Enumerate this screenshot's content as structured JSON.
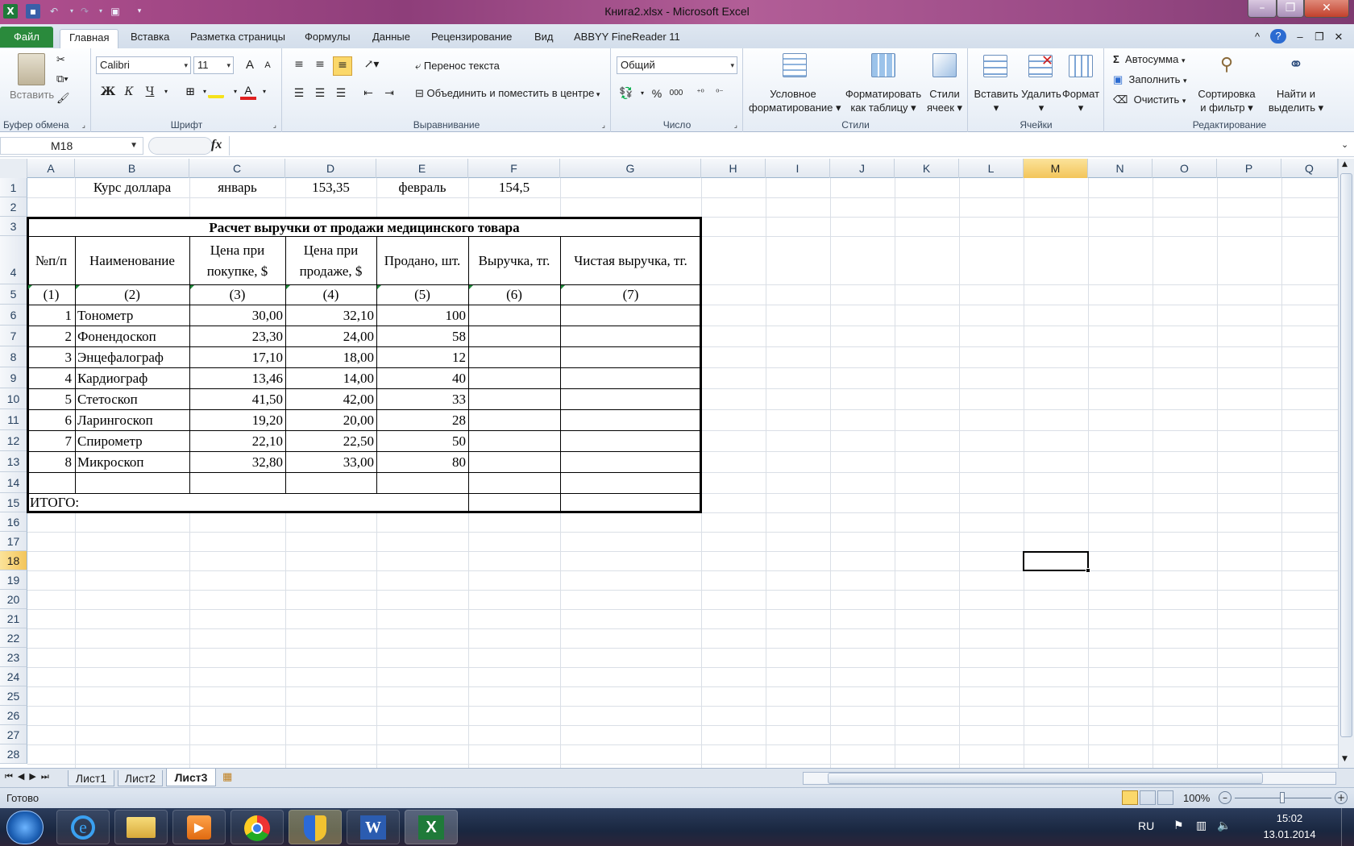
{
  "window": {
    "title": "Книга2.xlsx - Microsoft Excel"
  },
  "ribbon_tabs": [
    "Файл",
    "Главная",
    "Вставка",
    "Разметка страницы",
    "Формулы",
    "Данные",
    "Рецензирование",
    "Вид",
    "ABBYY FineReader 11"
  ],
  "clipboard": {
    "paste": "Вставить",
    "label": "Буфер обмена"
  },
  "font": {
    "name": "Calibri",
    "size": "11",
    "bold": "Ж",
    "italic": "К",
    "underline": "Ч",
    "label": "Шрифт",
    "grow": "A",
    "shrink": "A"
  },
  "alignment": {
    "wrap": "Перенос текста",
    "merge": "Объединить и поместить в центре",
    "label": "Выравнивание"
  },
  "number": {
    "format": "Общий",
    "percent": "%",
    "thousands": "000",
    "label": "Число"
  },
  "styles": {
    "conditional": [
      "Условное",
      "форматирование"
    ],
    "as_table": [
      "Форматировать",
      "как таблицу"
    ],
    "cell_styles": [
      "Стили",
      "ячеек"
    ],
    "label": "Стили"
  },
  "cells_group": {
    "insert": "Вставить",
    "delete": "Удалить",
    "format": "Формат",
    "label": "Ячейки"
  },
  "editing": {
    "autosum": "Автосумма",
    "fill": "Заполнить",
    "clear": "Очистить",
    "sort": [
      "Сортировка",
      "и фильтр"
    ],
    "find": [
      "Найти и",
      "выделить"
    ],
    "label": "Редактирование",
    "sigma": "Σ"
  },
  "formula_bar": {
    "name_box": "M18",
    "fx": "fx",
    "formula": ""
  },
  "columns": [
    "A",
    "B",
    "C",
    "D",
    "E",
    "F",
    "G",
    "H",
    "I",
    "J",
    "K",
    "L",
    "M",
    "N",
    "O",
    "P",
    "Q"
  ],
  "rows": [
    "1",
    "2",
    "3",
    "4",
    "5",
    "6",
    "7",
    "8",
    "9",
    "10",
    "11",
    "12",
    "13",
    "14",
    "15",
    "16",
    "17",
    "18",
    "19",
    "20",
    "21",
    "22",
    "23",
    "24",
    "25",
    "26",
    "27",
    "28"
  ],
  "active_cell": "M18",
  "sheet": {
    "rate": {
      "label": "Курс доллара",
      "m1": "январь",
      "v1": "153,35",
      "m2": "февраль",
      "v2": "154,5"
    },
    "table_title": "Расчет выручки от продажи медицинского товара",
    "headers": [
      "№п/п",
      "Наименование",
      "Цена при\nпокупке, $",
      "Цена при\nпродаже, $",
      "Продано, шт.",
      "Выручка, тг.",
      "Чистая выручка, тг."
    ],
    "header_c": [
      "Цена при",
      "покупке, $"
    ],
    "header_d": [
      "Цена при",
      "продаже, $"
    ],
    "col_numbers": [
      "(1)",
      "(2)",
      "(3)",
      "(4)",
      "(5)",
      "(6)",
      "(7)"
    ],
    "items": [
      {
        "n": "1",
        "name": "Тонометр",
        "buy": "30,00",
        "sell": "32,10",
        "sold": "100"
      },
      {
        "n": "2",
        "name": "Фонендоскоп",
        "buy": "23,30",
        "sell": "24,00",
        "sold": "58"
      },
      {
        "n": "3",
        "name": "Энцефалограф",
        "buy": "17,10",
        "sell": "18,00",
        "sold": "12"
      },
      {
        "n": "4",
        "name": "Кардиограф",
        "buy": "13,46",
        "sell": "14,00",
        "sold": "40"
      },
      {
        "n": "5",
        "name": "Стетоскоп",
        "buy": "41,50",
        "sell": "42,00",
        "sold": "33"
      },
      {
        "n": "6",
        "name": "Ларингоскоп",
        "buy": "19,20",
        "sell": "20,00",
        "sold": "28"
      },
      {
        "n": "7",
        "name": "Спирометр",
        "buy": "22,10",
        "sell": "22,50",
        "sold": "50"
      },
      {
        "n": "8",
        "name": "Микроскоп",
        "buy": "32,80",
        "sell": "33,00",
        "sold": "80"
      }
    ],
    "total_label": "ИТОГО:"
  },
  "sheet_tabs": [
    "Лист1",
    "Лист2",
    "Лист3"
  ],
  "active_sheet": "Лист3",
  "status": {
    "ready": "Готово",
    "zoom": "100%"
  },
  "taskbar": {
    "lang": "RU",
    "time": "15:02",
    "date": "13.01.2014"
  }
}
